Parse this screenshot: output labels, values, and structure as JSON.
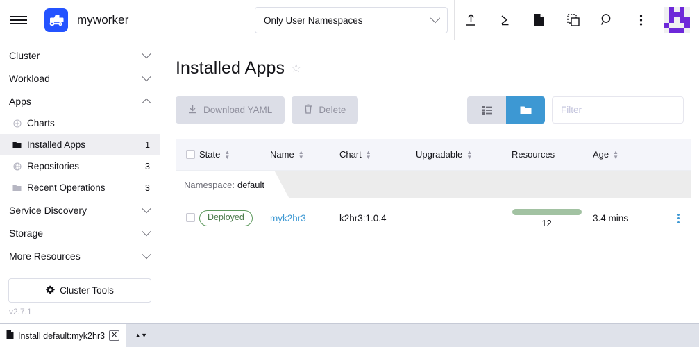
{
  "header": {
    "menu_icon": "hamburger-icon",
    "logo_icon": "rancher-logo-icon",
    "cluster_name": "myworker",
    "namespace_filter": {
      "value": "Only User Namespaces",
      "chevron_icon": "chevron-down-icon"
    },
    "actions": [
      {
        "name": "import-yaml-button",
        "icon": "upload-icon",
        "glyph": "upload"
      },
      {
        "name": "kubectl-shell-button",
        "icon": "terminal-icon",
        "glyph": "terminal"
      },
      {
        "name": "docs-button",
        "icon": "file-icon",
        "glyph": "file"
      },
      {
        "name": "copy-kubeconfig-button",
        "icon": "copy-icon",
        "glyph": "copy"
      },
      {
        "name": "search-button",
        "icon": "search-icon",
        "glyph": "search"
      },
      {
        "name": "overflow-menu-button",
        "icon": "kebab-menu-icon",
        "glyph": "kebab"
      }
    ],
    "avatar": {
      "name": "user-avatar",
      "color": "#6d28d9",
      "pattern": [
        0,
        1,
        0,
        1,
        0,
        0,
        1,
        1,
        1,
        0,
        0,
        1,
        0,
        1,
        1,
        1,
        0,
        0,
        0,
        1,
        0,
        1,
        1,
        1,
        0
      ]
    }
  },
  "sidebar": {
    "groups": [
      {
        "label": "Cluster",
        "expanded": false,
        "chevron": "chevron-down-icon",
        "key": "cluster"
      },
      {
        "label": "Workload",
        "expanded": false,
        "chevron": "chevron-down-icon",
        "key": "workload"
      },
      {
        "label": "Apps",
        "expanded": true,
        "chevron": "chevron-up-icon",
        "key": "apps"
      }
    ],
    "apps_items": [
      {
        "label": "Charts",
        "count": "",
        "icon": "plus-circle-icon",
        "glyph": "⊕",
        "active": false,
        "key": "charts"
      },
      {
        "label": "Installed Apps",
        "count": "1",
        "icon": "folder-icon",
        "glyph": "▰",
        "active": true,
        "key": "installed-apps"
      },
      {
        "label": "Repositories",
        "count": "3",
        "icon": "globe-icon",
        "glyph": "⊕",
        "active": false,
        "key": "repositories"
      },
      {
        "label": "Recent Operations",
        "count": "3",
        "icon": "folder-icon",
        "glyph": "▰",
        "active": false,
        "key": "recent-operations"
      }
    ],
    "groups_after": [
      {
        "label": "Service Discovery",
        "expanded": false,
        "chevron": "chevron-down-icon",
        "key": "service-discovery"
      },
      {
        "label": "Storage",
        "expanded": false,
        "chevron": "chevron-down-icon",
        "key": "storage"
      },
      {
        "label": "More Resources",
        "expanded": false,
        "chevron": "chevron-down-icon",
        "key": "more-resources"
      }
    ],
    "cluster_tools": {
      "label": "Cluster Tools",
      "icon": "gear-icon"
    },
    "version": "v2.7.1"
  },
  "main": {
    "title": "Installed Apps",
    "favorite_icon": "star-outline-icon",
    "toolbar": {
      "download_yaml": {
        "label": "Download YAML",
        "icon": "download-icon",
        "disabled": true
      },
      "delete": {
        "label": "Delete",
        "icon": "trash-icon",
        "disabled": true
      },
      "view_flat": {
        "name": "flat-list-view-toggle",
        "icon": "list-icon",
        "selected": false
      },
      "view_grouped": {
        "name": "grouped-view-toggle",
        "icon": "folder-icon",
        "selected": true
      },
      "filter_placeholder": "Filter",
      "filter_value": ""
    },
    "table": {
      "columns": [
        {
          "label": "State",
          "sortable": true,
          "key": "state"
        },
        {
          "label": "Name",
          "sortable": true,
          "key": "name"
        },
        {
          "label": "Chart",
          "sortable": true,
          "key": "chart"
        },
        {
          "label": "Upgradable",
          "sortable": true,
          "key": "upgradable"
        },
        {
          "label": "Resources",
          "sortable": false,
          "key": "resources"
        },
        {
          "label": "Age",
          "sortable": true,
          "key": "age"
        }
      ],
      "group": {
        "key_label": "Namespace:",
        "value": "default"
      },
      "rows": [
        {
          "state": "Deployed",
          "state_color": "#5d995d",
          "name": "myk2hr3",
          "chart": "k2hr3:1.0.4",
          "upgradable": "—",
          "resources_count": "12",
          "resources_bar_color": "#a2c2a2",
          "age": "3.4 mins",
          "actions_icon": "kebab-menu-icon"
        }
      ]
    }
  },
  "statusbar": {
    "task": {
      "icon": "file-icon",
      "label": "Install default:myk2hr3",
      "close_label": "✕",
      "close_icon": "close-icon"
    },
    "expand_icon": "expand-collapse-icon"
  }
}
